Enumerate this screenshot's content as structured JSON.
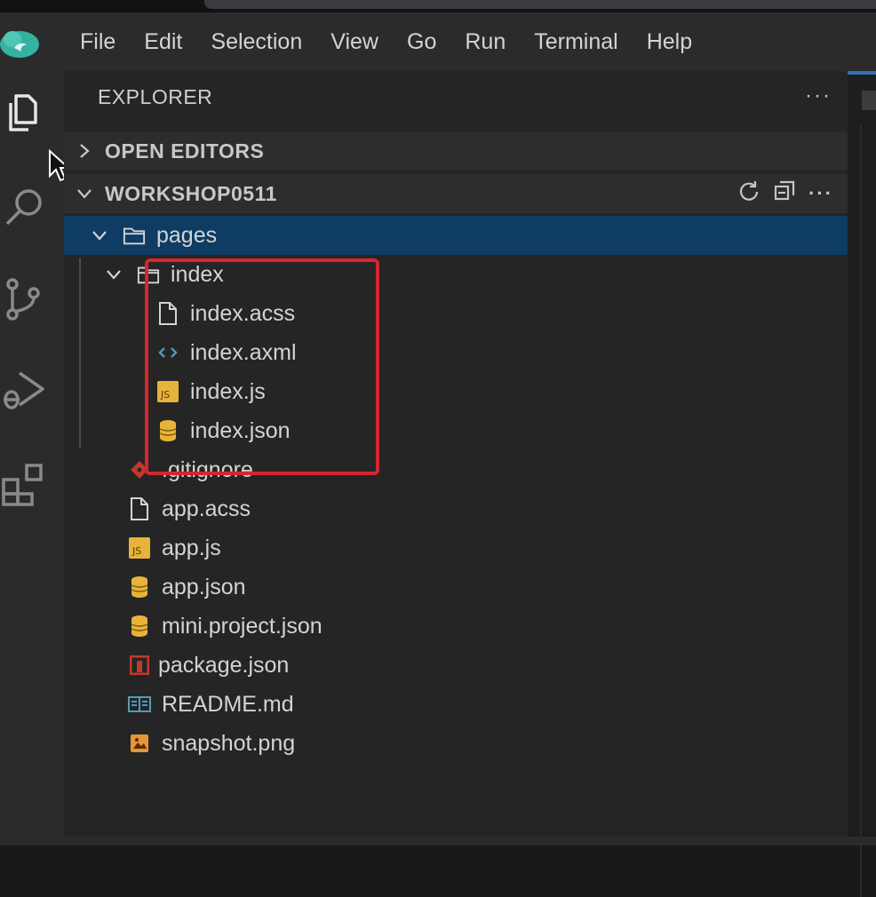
{
  "menu": [
    "File",
    "Edit",
    "Selection",
    "View",
    "Go",
    "Run",
    "Terminal",
    "Help"
  ],
  "sidebar": {
    "title": "EXPLORER",
    "more": "···",
    "open_editors": "OPEN EDITORS",
    "workspace": "WORKSHOP0511"
  },
  "tree": [
    {
      "label": "pages",
      "icon": "folder-open-icon"
    },
    {
      "label": "index",
      "icon": "folder-open-icon"
    },
    {
      "label": "index.acss",
      "icon": "file-icon"
    },
    {
      "label": "index.axml",
      "icon": "code-brackets-icon"
    },
    {
      "label": "index.js",
      "icon": "javascript-icon"
    },
    {
      "label": "index.json",
      "icon": "json-database-icon"
    },
    {
      "label": ".gitignore",
      "icon": "git-icon"
    },
    {
      "label": "app.acss",
      "icon": "file-icon"
    },
    {
      "label": "app.js",
      "icon": "javascript-icon"
    },
    {
      "label": "app.json",
      "icon": "json-database-icon"
    },
    {
      "label": "mini.project.json",
      "icon": "json-database-icon"
    },
    {
      "label": "package.json",
      "icon": "npm-package-icon"
    },
    {
      "label": "README.md",
      "icon": "readme-book-icon"
    },
    {
      "label": "snapshot.png",
      "icon": "image-icon"
    }
  ],
  "colors": {
    "selection": "#0e3c63",
    "highlight_box": "#d6262e",
    "js_yellow": "#e8b33a",
    "json_yellow": "#e8b33a"
  }
}
